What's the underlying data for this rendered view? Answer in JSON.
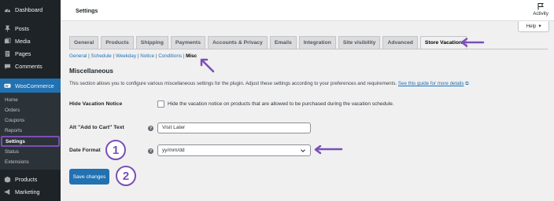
{
  "sidebar": {
    "top_items": [
      {
        "label": "Dashboard",
        "icon": "dashboard-icon"
      },
      {
        "label": "Posts",
        "icon": "pin-icon"
      },
      {
        "label": "Media",
        "icon": "media-icon"
      },
      {
        "label": "Pages",
        "icon": "pages-icon"
      },
      {
        "label": "Comments",
        "icon": "comments-icon"
      }
    ],
    "woocommerce": {
      "label": "WooCommerce",
      "icon": "woocommerce-icon"
    },
    "submenu": [
      "Home",
      "Orders",
      "Coupons",
      "Reports",
      "Settings",
      "Status",
      "Extensions"
    ],
    "current_submenu": "Settings",
    "bottom_items": [
      {
        "label": "Products",
        "icon": "products-icon"
      },
      {
        "label": "Marketing",
        "icon": "marketing-icon"
      }
    ]
  },
  "header": {
    "title": "Settings",
    "activity_label": "Activity",
    "help_label": "Help"
  },
  "tabs": [
    "General",
    "Products",
    "Shipping",
    "Payments",
    "Accounts & Privacy",
    "Emails",
    "Integration",
    "Site visibility",
    "Advanced",
    "Store Vacation"
  ],
  "active_tab": "Store Vacation",
  "subsections": {
    "links": [
      "General",
      "Schedule",
      "Weekday",
      "Notice",
      "Conditions"
    ],
    "current": "Misc"
  },
  "section": {
    "title": "Miscellaneous",
    "description": "This section allows you to configure various miscellaneous settings for the plugin. Adjust these settings according to your preferences and requirements.",
    "guide_link": "See this guide for more details"
  },
  "fields": {
    "hide_notice": {
      "label": "Hide Vacation Notice",
      "description": "Hide the vacation notice on products that are allowed to be purchased during the vacation schedule.",
      "checked": false
    },
    "alt_cart_text": {
      "label": "Alt \"Add to Cart\" Text",
      "value": "Visit Later"
    },
    "date_format": {
      "label": "Date Format",
      "value": "yy/mm/dd"
    }
  },
  "save_label": "Save changes",
  "annotations": {
    "step1": "1",
    "step2": "2",
    "accent_color": "#7b4fb6"
  },
  "colors": {
    "sidebar_bg": "#1d2327",
    "wc_highlight": "#2271b1",
    "primary_button": "#2271b1",
    "link": "#2271b1"
  }
}
